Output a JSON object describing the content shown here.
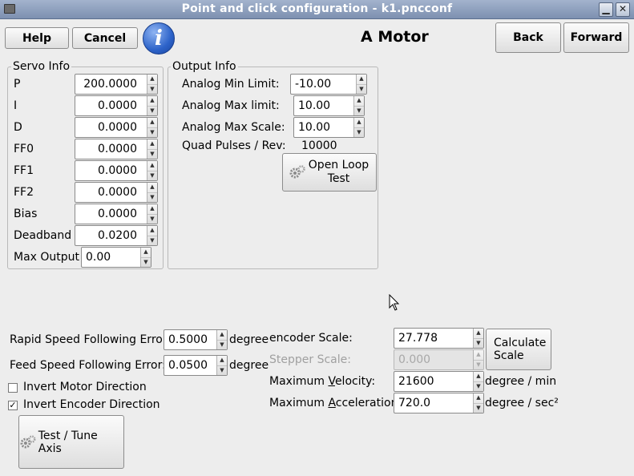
{
  "window": {
    "title": "Point and click configuration - k1.pncconf",
    "minimize_glyph": "▁",
    "close_glyph": "✕"
  },
  "toolbar": {
    "help_label": "Help",
    "cancel_label": "Cancel",
    "info_glyph": "i",
    "page_title": "A Motor",
    "back_label": "Back",
    "forward_label": "Forward"
  },
  "servo_info": {
    "title": "Servo Info",
    "fields": [
      {
        "label": "P",
        "value": "200.0000"
      },
      {
        "label": "I",
        "value": "0.0000"
      },
      {
        "label": "D",
        "value": "0.0000"
      },
      {
        "label": "FF0",
        "value": "0.0000"
      },
      {
        "label": "FF1",
        "value": "0.0000"
      },
      {
        "label": "FF2",
        "value": "0.0000"
      },
      {
        "label": "Bias",
        "value": "0.0000"
      },
      {
        "label": "Deadband",
        "value": "0.0200"
      }
    ],
    "max_output": {
      "label": "Max Output",
      "value": "0.00"
    }
  },
  "output_info": {
    "title": "Output Info",
    "analog_min": {
      "label": "Analog Min Limit:",
      "value": "-10.00"
    },
    "analog_max": {
      "label": "Analog Max limit:",
      "value": "10.00"
    },
    "analog_scale": {
      "label": "Analog Max Scale:",
      "value": "10.00"
    },
    "quad_pulses": {
      "label": "Quad Pulses / Rev:",
      "value": "10000"
    },
    "open_loop_label_1": "Open Loop",
    "open_loop_label_2": "Test"
  },
  "following": {
    "rapid": {
      "label": "Rapid Speed Following Error:",
      "value": "0.5000",
      "unit": "degree"
    },
    "feed": {
      "label": "Feed Speed Following Error:",
      "value": "0.0500",
      "unit": "degree"
    }
  },
  "checkboxes": {
    "invert_motor": {
      "label": "Invert Motor Direction",
      "checked": false,
      "glyph": ""
    },
    "invert_encoder": {
      "label": "Invert Encoder Direction",
      "checked": true,
      "glyph": "✓"
    }
  },
  "test_tune_label": "Test / Tune Axis",
  "scales": {
    "encoder": {
      "label": "encoder Scale:",
      "value": "27.778"
    },
    "stepper": {
      "label": "Stepper Scale:",
      "value": "0.000",
      "disabled": true
    },
    "calculate_label_1": "Calculate",
    "calculate_label_2": "Scale",
    "max_velocity": {
      "label_pre": "Maximum ",
      "label_u": "V",
      "label_post": "elocity:",
      "value": "21600",
      "unit": "degree / min"
    },
    "max_accel": {
      "label_pre": "Maximum ",
      "label_u": "A",
      "label_post": "cceleration:",
      "value": "720.0",
      "unit": "degree / sec²"
    }
  },
  "arrows": {
    "up": "▲",
    "down": "▼"
  },
  "icons": {
    "gear": "gear-icon",
    "info": "info-icon",
    "cursor": "mouse-pointer-icon"
  }
}
